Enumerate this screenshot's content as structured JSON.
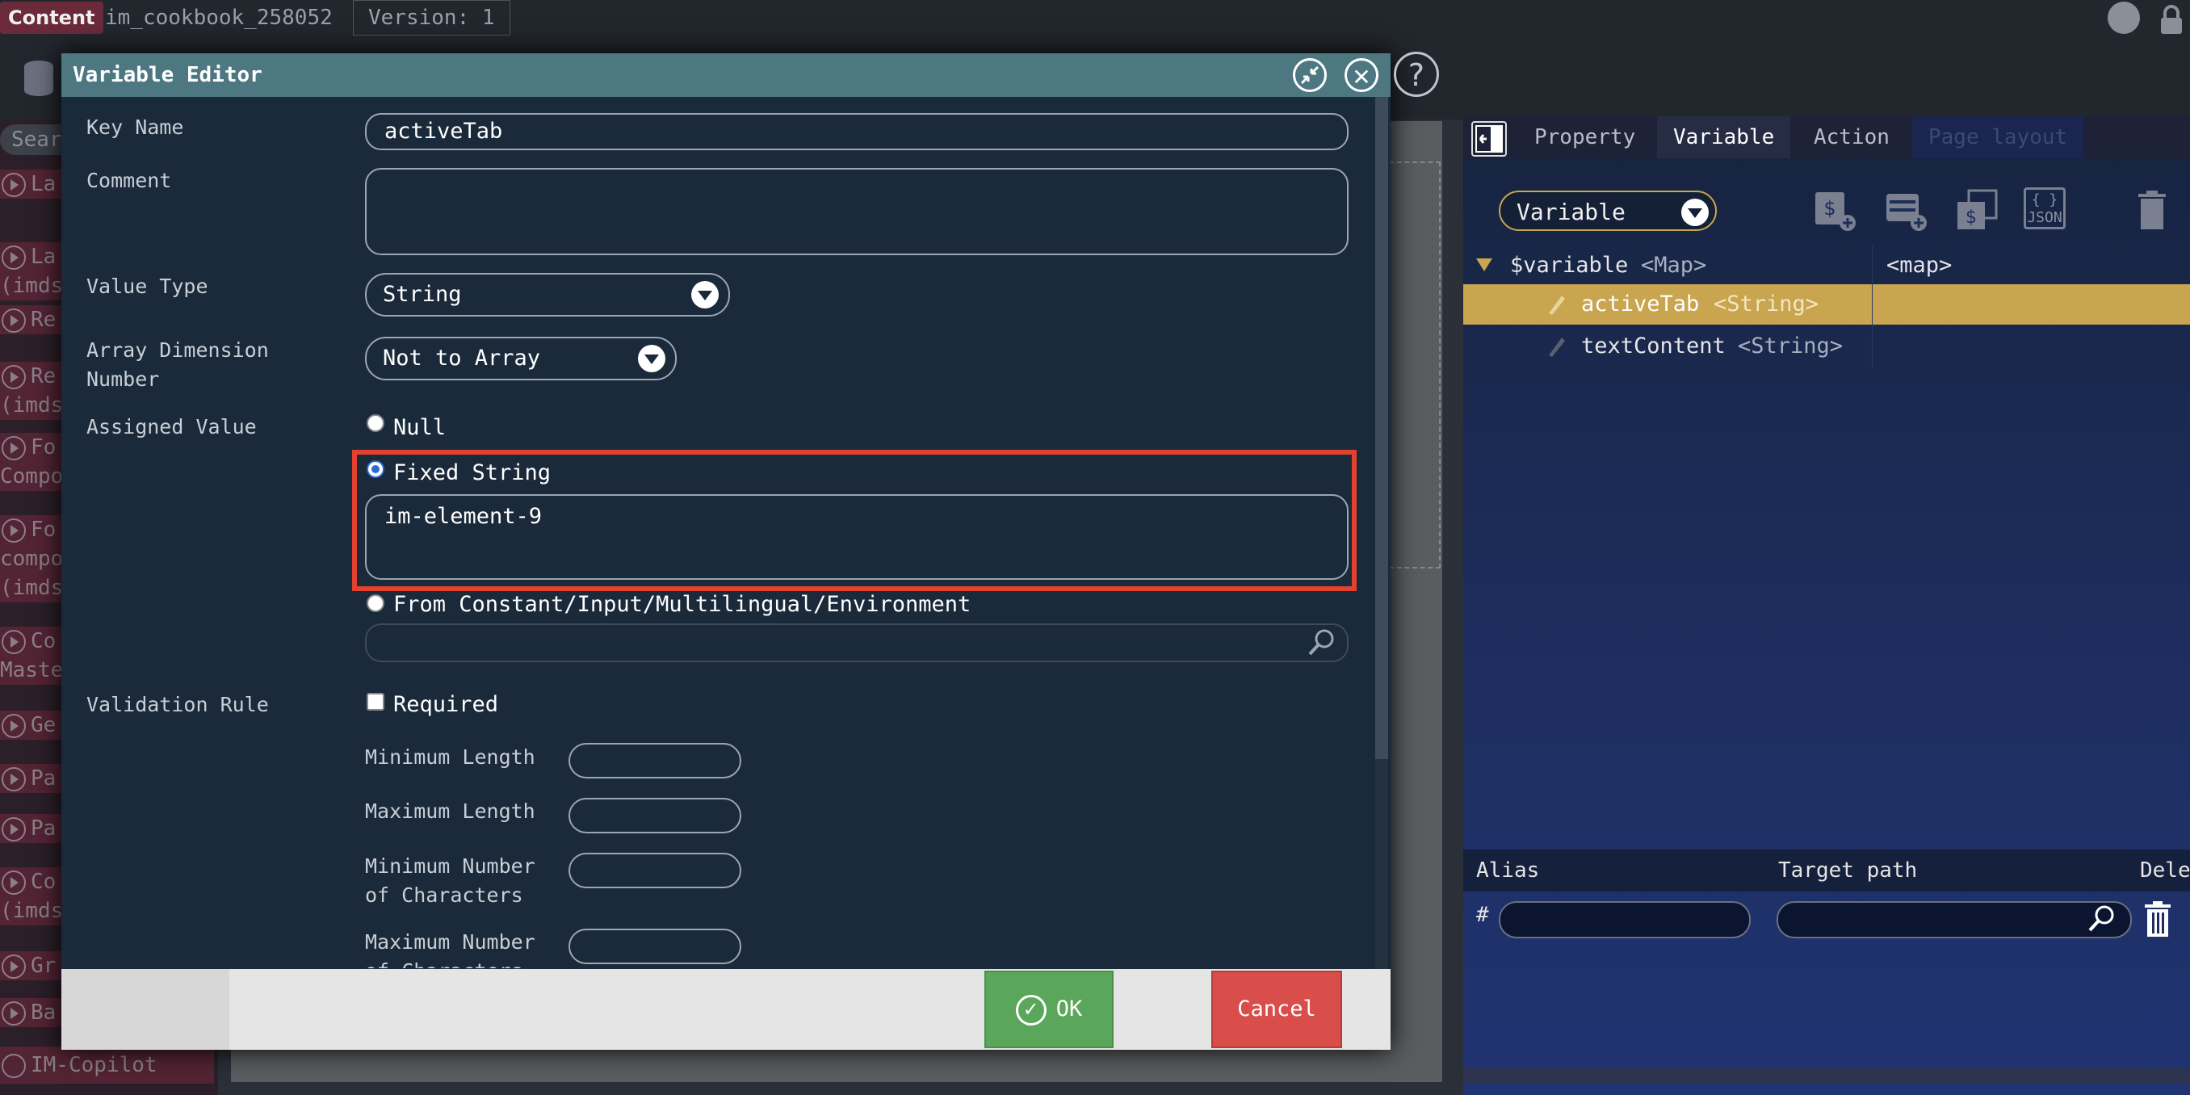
{
  "topbar": {
    "content_badge": "Content",
    "app_name": "im_cookbook_258052",
    "version": "Version: 1"
  },
  "left_sidebar": {
    "search_placeholder": "Sear",
    "items": [
      {
        "label": "La"
      },
      {
        "label": "La\n(imds"
      },
      {
        "label": "Re"
      },
      {
        "label": "Re\n(imds"
      },
      {
        "label": "Fo\nCompo"
      },
      {
        "label": "Fo\ncompo\n(imds"
      },
      {
        "label": "Co\nMaste"
      },
      {
        "label": "Ge"
      },
      {
        "label": "Pa"
      },
      {
        "label": "Pa"
      },
      {
        "label": "Co\n(imds"
      },
      {
        "label": "Gr"
      },
      {
        "label": "Ba"
      }
    ],
    "copilot": "IM-Copilot"
  },
  "right_panel": {
    "tabs": [
      "Property",
      "Variable",
      "Action",
      "Page layout"
    ],
    "active_tab": "Variable",
    "select_value": "Variable",
    "tools": [
      {
        "icon": "add-variable-icon"
      },
      {
        "icon": "add-db-variable-icon"
      },
      {
        "icon": "copy-variable-icon"
      },
      {
        "icon": "json-icon",
        "label": "JSON"
      },
      {
        "icon": "trash-icon"
      }
    ],
    "tree": {
      "root": {
        "name": "$variable",
        "type": "<Map>",
        "value": "<map>"
      },
      "items": [
        {
          "name": "activeTab",
          "type": "<String>",
          "selected": true
        },
        {
          "name": "textContent",
          "type": "<String>",
          "selected": false
        }
      ]
    },
    "alias": {
      "headers": [
        "Alias",
        "Target path",
        "Dele"
      ],
      "row_marker": "#",
      "alias_value": "",
      "target_value": ""
    }
  },
  "dialog": {
    "title": "Variable Editor",
    "help": "?",
    "labels": {
      "key_name": "Key Name",
      "comment": "Comment",
      "value_type": "Value Type",
      "array_dim": "Array Dimension\nNumber",
      "assigned_value": "Assigned Value",
      "validation_rule": "Validation Rule",
      "min_length": "Minimum Length",
      "max_length": "Maximum Length",
      "min_chars": "Minimum Number\nof Characters",
      "max_chars": "Maximum Number\nof Characters"
    },
    "values": {
      "key_name": "activeTab",
      "comment": "",
      "value_type": "String",
      "array_dim": "Not to Array",
      "fixed_string": "im-element-9",
      "constant_value": ""
    },
    "radios": {
      "null": "Null",
      "fixed": "Fixed String",
      "from_constant": "From Constant/Input/Multilingual/Environment",
      "selected": "fixed"
    },
    "required_label": "Required",
    "ok_label": "OK",
    "cancel_label": "Cancel"
  },
  "colors": {
    "highlight": "#e3402d",
    "ok": "#5aa65a",
    "cancel": "#d94d4a",
    "selected_row": "#c9a550"
  }
}
